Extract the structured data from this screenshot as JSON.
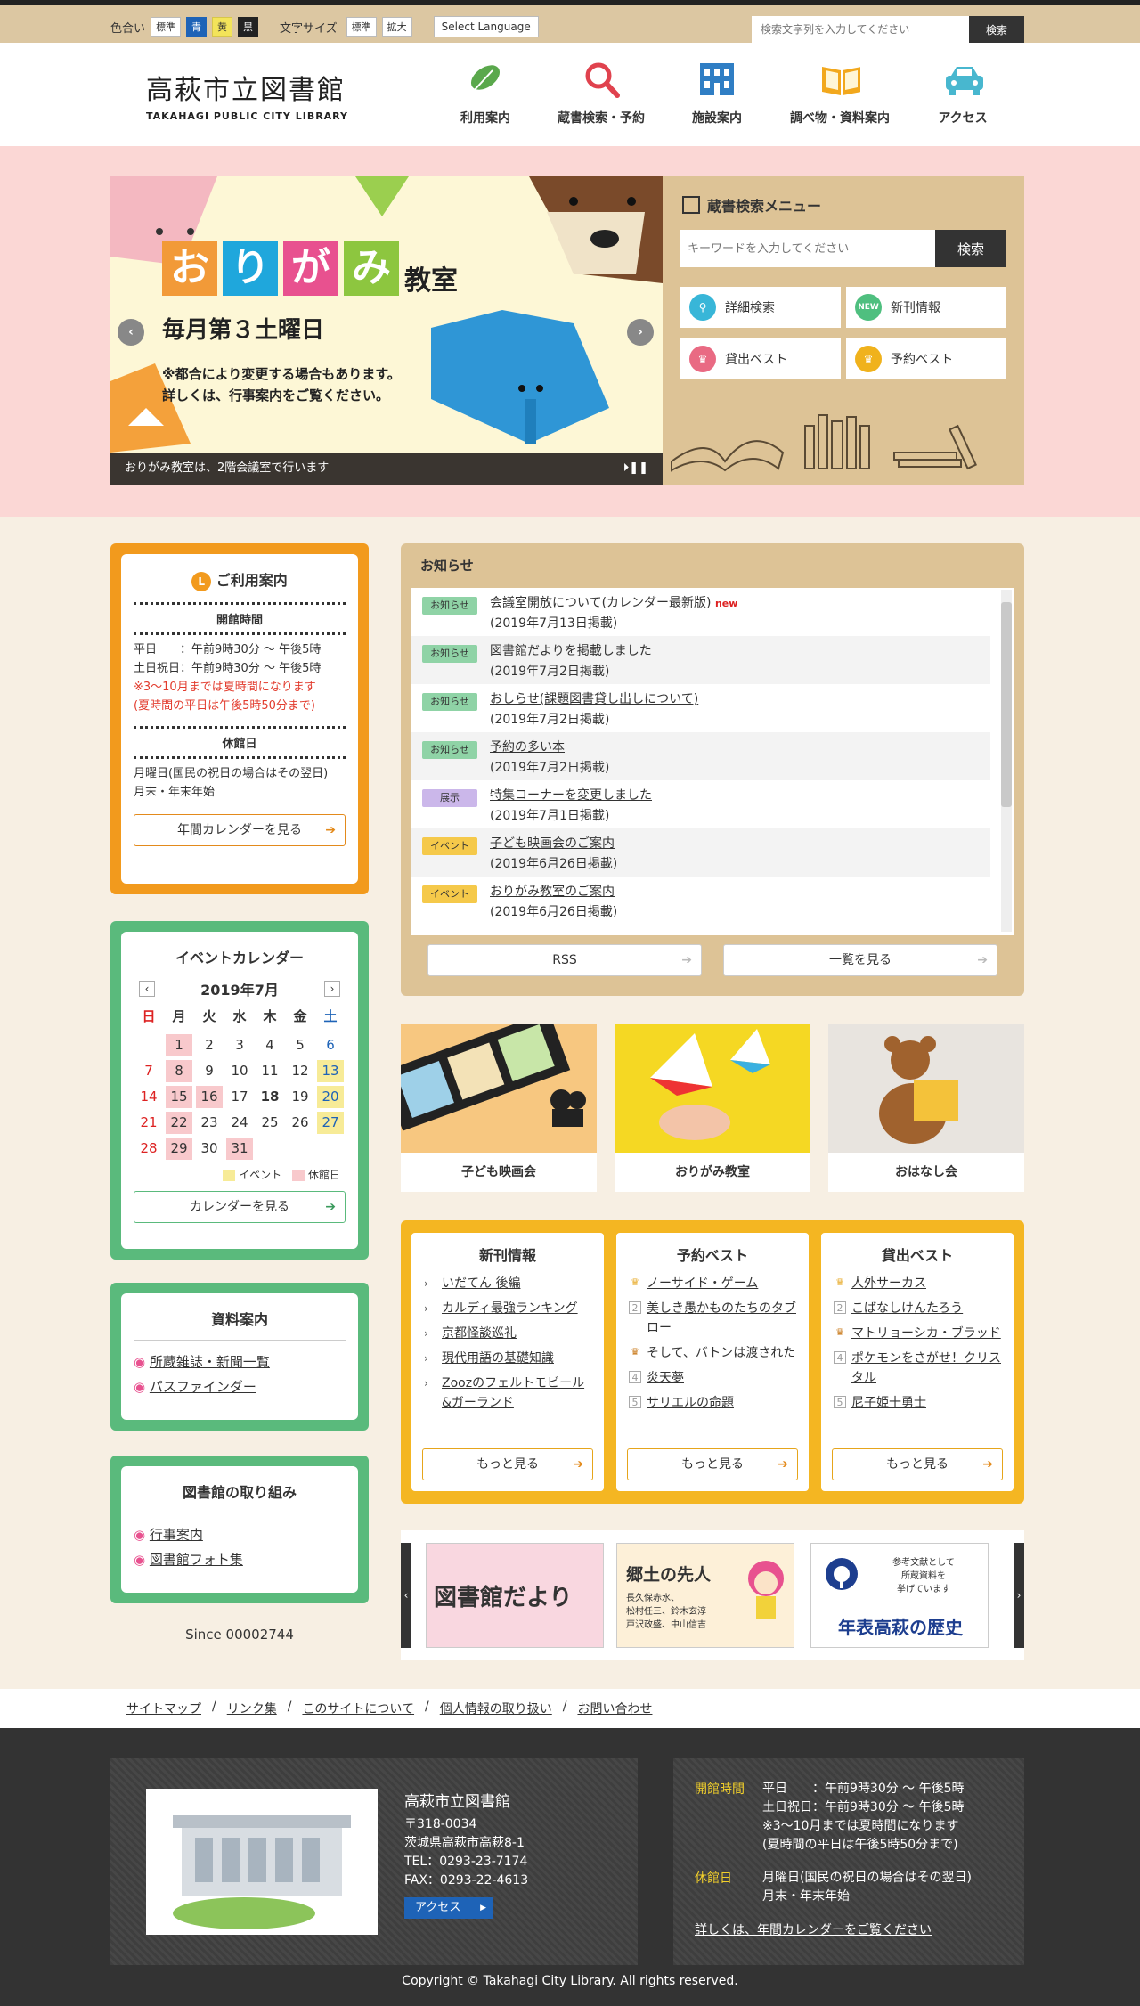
{
  "topbar": {
    "color_label": "色合い",
    "colors": [
      "標準",
      "青",
      "黄",
      "黒"
    ],
    "size_label": "文字サイズ",
    "sizes": [
      "標準",
      "拡大"
    ],
    "language": "Select Language",
    "search_placeholder": "検索文字列を入力してください",
    "search_button": "検索"
  },
  "header": {
    "logo_jp": "高萩市立図書館",
    "logo_en": "TAKAHAGI PUBLIC CITY LIBRARY",
    "nav": [
      "利用案内",
      "蔵書検索・予約",
      "施設案内",
      "調べ物・資料案内",
      "アクセス"
    ]
  },
  "slider": {
    "title_chars": [
      "お",
      "り",
      "が",
      "み"
    ],
    "title_suffix": "教室",
    "subtitle": "毎月第３土曜日",
    "note1": "※都合により変更する場合もあります。",
    "note2": "詳しくは、行事案内をご覧ください。",
    "caption": "おりがみ教室は、2階会議室で行います"
  },
  "search_menu": {
    "title": "蔵書検索メニュー",
    "placeholder": "キーワードを入力してください",
    "button": "検索",
    "items": [
      "詳細検索",
      "新刊情報",
      "貸出ベスト",
      "予約ベスト"
    ],
    "new_badge": "NEW"
  },
  "guide": {
    "title": "ご利用案内",
    "hours_title": "開館時間",
    "hours": [
      "平日　　：午前9時30分 ～ 午後5時",
      "土日祝日：午前9時30分 ～ 午後5時"
    ],
    "summer": [
      "※3～10月までは夏時間になります",
      "(夏時間の平日は午後5時50分まで)"
    ],
    "closed_title": "休館日",
    "closed": [
      "月曜日(国民の祝日の場合はその翌日)",
      "月末・年末年始"
    ],
    "button": "年間カレンダーを見る"
  },
  "calendar": {
    "title": "イベントカレンダー",
    "month": "2019年7月",
    "weekdays": [
      "日",
      "月",
      "火",
      "水",
      "木",
      "金",
      "土"
    ],
    "days": [
      "",
      "1",
      "2",
      "3",
      "4",
      "5",
      "6",
      "7",
      "8",
      "9",
      "10",
      "11",
      "12",
      "13",
      "14",
      "15",
      "16",
      "17",
      "18",
      "19",
      "20",
      "21",
      "22",
      "23",
      "24",
      "25",
      "26",
      "27",
      "28",
      "29",
      "30",
      "31",
      "",
      "",
      ""
    ],
    "legend_event": "イベント",
    "legend_closed": "休館日",
    "button": "カレンダーを見る"
  },
  "materials": {
    "title": "資料案内",
    "links": [
      "所蔵雑誌・新聞一覧",
      "パスファインダー"
    ]
  },
  "efforts": {
    "title": "図書館の取り組み",
    "links": [
      "行事案内",
      "図書館フォト集"
    ]
  },
  "since": "Since 00002744",
  "notice": {
    "title": "お知らせ",
    "items": [
      {
        "tag": "お知らせ",
        "title": "会議室開放について(カレンダー最新版)",
        "date": "(2019年7月13日掲載)",
        "new": "new"
      },
      {
        "tag": "お知らせ",
        "title": "図書館だよりを掲載しました",
        "date": "(2019年7月2日掲載)",
        "new": ""
      },
      {
        "tag": "お知らせ",
        "title": "おしらせ(課題図書貸し出しについて)",
        "date": "(2019年7月2日掲載)",
        "new": ""
      },
      {
        "tag": "お知らせ",
        "title": "予約の多い本",
        "date": "(2019年7月2日掲載)",
        "new": ""
      },
      {
        "tag": "展示",
        "title": "特集コーナーを変更しました",
        "date": "(2019年7月1日掲載)",
        "new": ""
      },
      {
        "tag": "イベント",
        "title": "子ども映画会のご案内",
        "date": "(2019年6月26日掲載)",
        "new": ""
      },
      {
        "tag": "イベント",
        "title": "おりがみ教室のご案内",
        "date": "(2019年6月26日掲載)",
        "new": ""
      }
    ],
    "rss": "RSS",
    "list": "一覧を見る"
  },
  "thumbs": [
    "子ども映画会",
    "おりがみ教室",
    "おはなし会"
  ],
  "lists": {
    "new": {
      "title": "新刊情報",
      "items": [
        "いだてん 後編",
        "カルディ最強ランキング",
        "京都怪談巡礼",
        "現代用語の基礎知識",
        "Zoozのフェルトモビール&ガーランド"
      ]
    },
    "reserve": {
      "title": "予約ベスト",
      "items": [
        "ノーサイド・ゲーム",
        "美しき愚かものたちのタブロー",
        "そして、バトンは渡された",
        "炎天夢",
        "サリエルの命題"
      ]
    },
    "loan": {
      "title": "貸出ベスト",
      "items": [
        "人外サーカス",
        "こばなしけんたろう",
        "マトリョーシカ・ブラッド",
        "ポケモンをさがせ！クリスタル",
        "尼子姫十勇士"
      ]
    },
    "more": "もっと見る"
  },
  "banners": {
    "b1": "図書館だより",
    "b2_title": "郷土の先人",
    "b2_names": [
      "長久保赤水、",
      "松村任三、鈴木玄淳",
      "戸沢政盛、中山信吉"
    ],
    "b3_text": [
      "参考文献として",
      "所蔵資料を",
      "挙げています"
    ],
    "b3_title": "年表高萩の歴史"
  },
  "footer_links": [
    "サイトマップ",
    "リンク集",
    "このサイトについて",
    "個人情報の取り扱い",
    "お問い合わせ"
  ],
  "footer": {
    "name": "高萩市立図書館",
    "zip": "〒318-0034",
    "addr": "茨城県高萩市高萩8-1",
    "tel": "TEL：0293-23-7174",
    "fax": "FAX：0293-22-4613",
    "access": "アクセス",
    "hours_label": "開館時間",
    "hours": [
      "平日　　：午前9時30分 ～ 午後5時",
      "土日祝日：午前9時30分 ～ 午後5時",
      "※3～10月までは夏時間になります",
      "(夏時間の平日は午後5時50分まで)"
    ],
    "closed_label": "休館日",
    "closed": [
      "月曜日(国民の祝日の場合はその翌日)",
      "月末・年末年始"
    ],
    "detail": "詳しくは、年間カレンダーをご覧ください",
    "copyright": "Copyright © Takahagi City Library. All rights reserved."
  }
}
